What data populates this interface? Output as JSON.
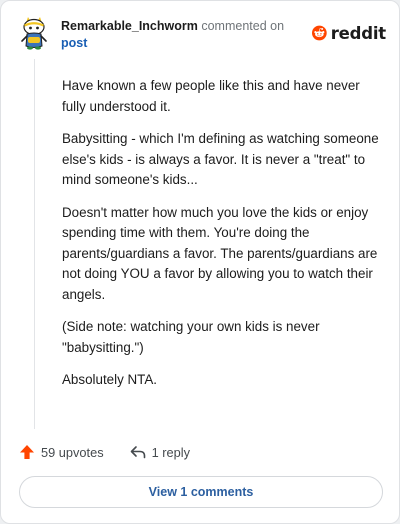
{
  "header": {
    "username": "Remarkable_Inchworm",
    "action_text": "commented on",
    "post_link": "post",
    "logo_word": "reddit"
  },
  "comment": {
    "paragraphs": [
      "Have known a few people like this and have never fully understood it.",
      "Babysitting - which I'm defining as watching someone else's kids - is always a favor. It is never a \"treat\" to mind someone's kids...",
      "Doesn't matter how much you love the kids or enjoy spending time with them. You're doing the parents/guardians a favor. The parents/guardians are not doing YOU a favor by allowing you to watch their angels.",
      "(Side note: watching your own kids is never \"babysitting.\")",
      "Absolutely NTA."
    ]
  },
  "actions": {
    "upvotes": "59 upvotes",
    "replies": "1 reply",
    "view_comments": "View 1 comments"
  },
  "colors": {
    "upvote": "#ff4500",
    "brand": "#ff4500",
    "link": "#1a5fb4"
  },
  "icons": {
    "avatar": "snoo-avatar-icon",
    "logo": "reddit-snoo-icon",
    "upvote": "upvote-arrow-icon",
    "reply": "reply-arrow-icon"
  }
}
